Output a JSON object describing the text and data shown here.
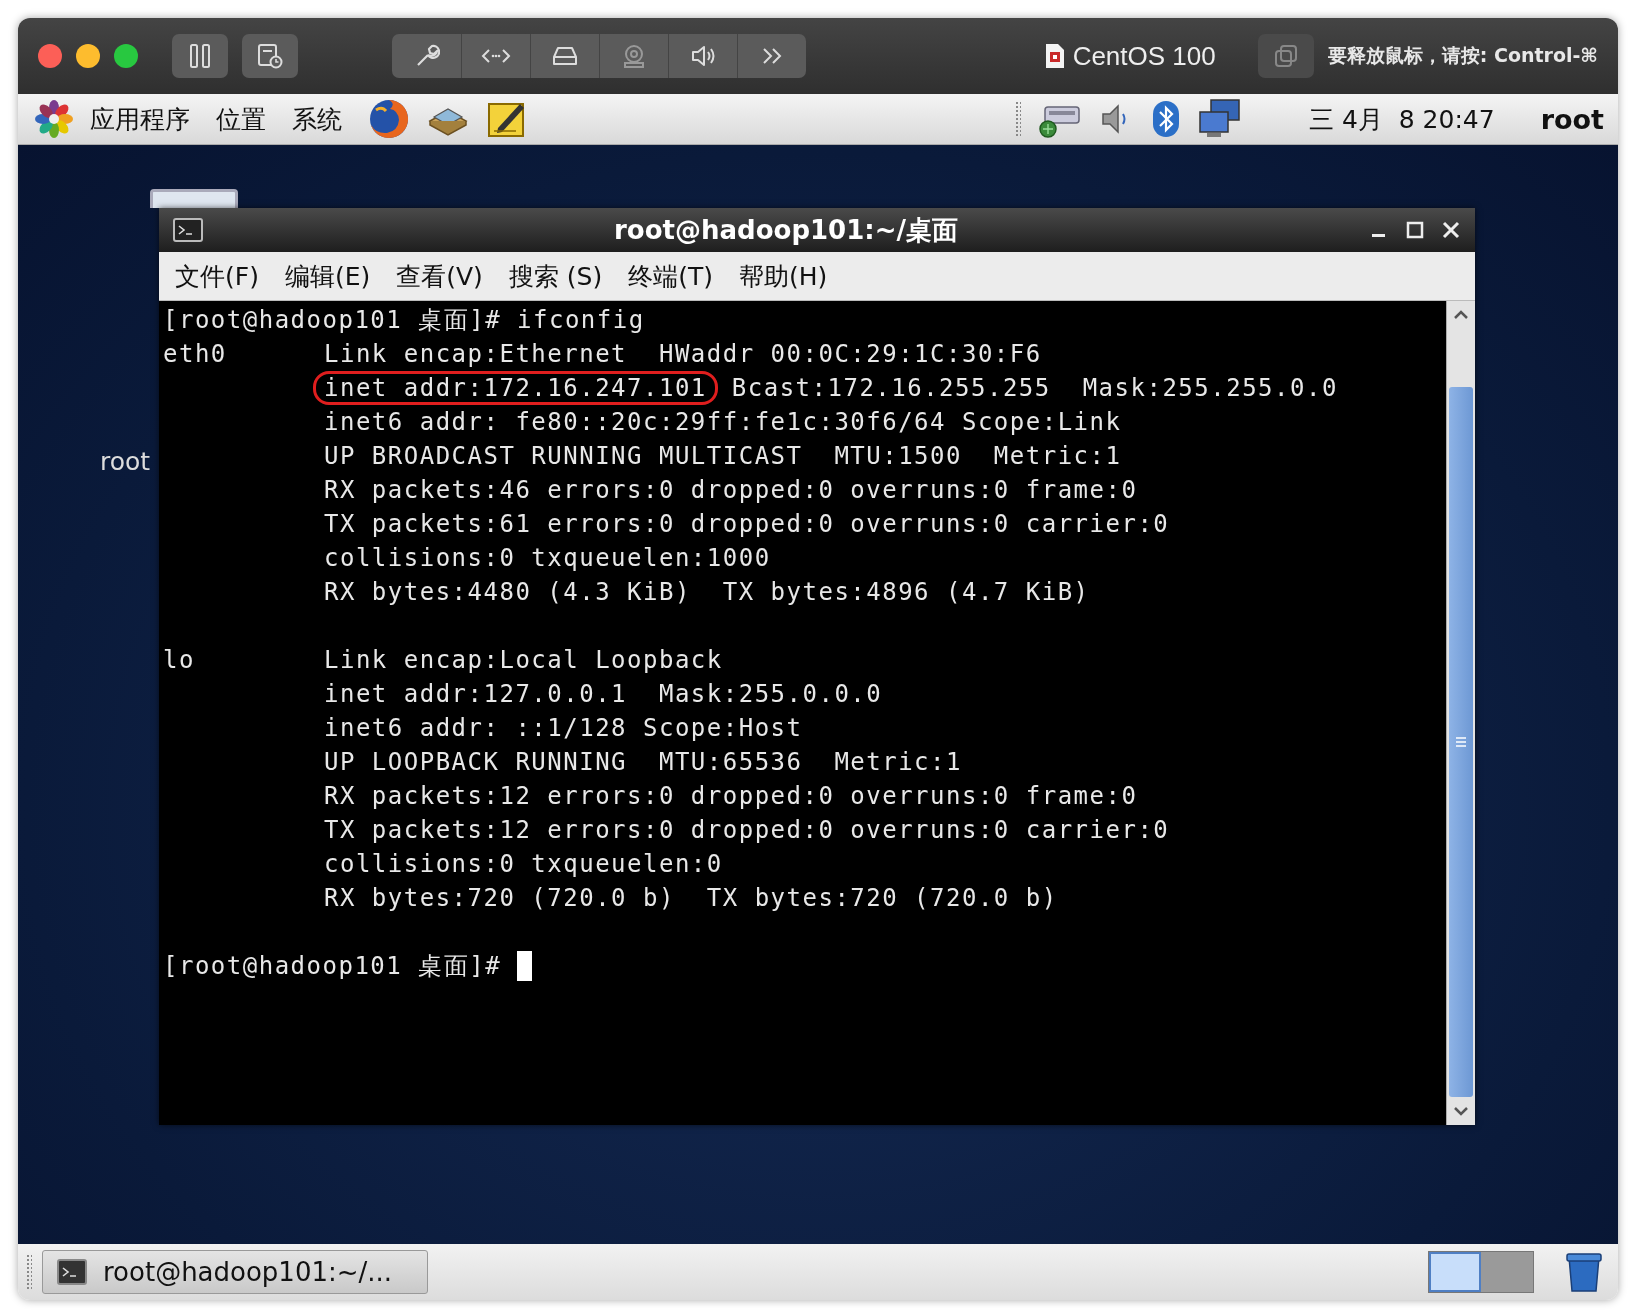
{
  "vm_toolbar": {
    "title": "CentOS 100",
    "hint": "要释放鼠标，请按: Control-⌘"
  },
  "panel": {
    "menus": [
      "应用程序",
      "位置",
      "系统"
    ],
    "clock": "三 4月  8 20:47",
    "user": "root"
  },
  "desktop": {
    "icon_label": "root"
  },
  "terminal": {
    "title": "root@hadoop101:~/桌面",
    "menu": [
      "文件(F)",
      "编辑(E)",
      "查看(V)",
      "搜索 (S)",
      "终端(T)",
      "帮助(H)"
    ],
    "lines": [
      {
        "kind": "prompt",
        "text": "[root@hadoop101 桌面]# ifconfig",
        "cursor": false
      },
      {
        "kind": "output",
        "iface": "eth0",
        "text": "Link encap:Ethernet  HWaddr 00:0C:29:1C:30:F6"
      },
      {
        "kind": "output",
        "circled": "inet addr:172.16.247.101",
        "text": "Bcast:172.16.255.255  Mask:255.255.0.0"
      },
      {
        "kind": "output",
        "text": "inet6 addr: fe80::20c:29ff:fe1c:30f6/64 Scope:Link"
      },
      {
        "kind": "output",
        "text": "UP BROADCAST RUNNING MULTICAST  MTU:1500  Metric:1"
      },
      {
        "kind": "output",
        "text": "RX packets:46 errors:0 dropped:0 overruns:0 frame:0"
      },
      {
        "kind": "output",
        "text": "TX packets:61 errors:0 dropped:0 overruns:0 carrier:0"
      },
      {
        "kind": "output",
        "text": "collisions:0 txqueuelen:1000"
      },
      {
        "kind": "output",
        "text": "RX bytes:4480 (4.3 KiB)  TX bytes:4896 (4.7 KiB)"
      },
      {
        "kind": "blank"
      },
      {
        "kind": "output",
        "iface": "lo",
        "text": "Link encap:Local Loopback"
      },
      {
        "kind": "output",
        "text": "inet addr:127.0.0.1  Mask:255.0.0.0"
      },
      {
        "kind": "output",
        "text": "inet6 addr: ::1/128 Scope:Host"
      },
      {
        "kind": "output",
        "text": "UP LOOPBACK RUNNING  MTU:65536  Metric:1"
      },
      {
        "kind": "output",
        "text": "RX packets:12 errors:0 dropped:0 overruns:0 frame:0"
      },
      {
        "kind": "output",
        "text": "TX packets:12 errors:0 dropped:0 overruns:0 carrier:0"
      },
      {
        "kind": "output",
        "text": "collisions:0 txqueuelen:0"
      },
      {
        "kind": "output",
        "text": "RX bytes:720 (720.0 b)  TX bytes:720 (720.0 b)"
      },
      {
        "kind": "blank"
      },
      {
        "kind": "prompt",
        "text": "[root@hadoop101 桌面]# ",
        "cursor": true
      }
    ]
  },
  "taskbar": {
    "tasks": [
      {
        "label": "root@hadoop101:~/..."
      }
    ],
    "workspaces": [
      {
        "selected": true
      },
      {
        "selected": false
      }
    ]
  }
}
